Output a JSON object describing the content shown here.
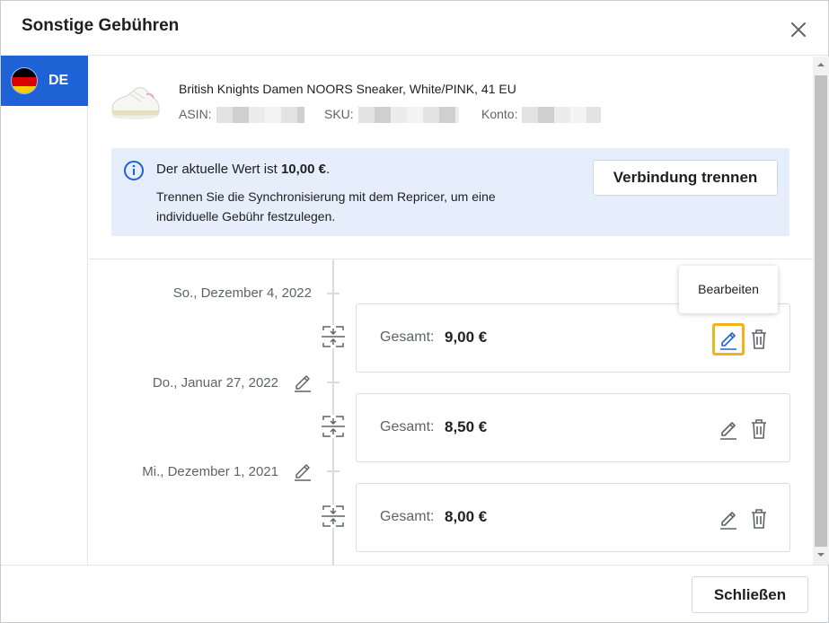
{
  "dialog": {
    "title": "Sonstige Gebühren"
  },
  "sidebar": {
    "marketplace_tab": {
      "label": "DE"
    }
  },
  "product": {
    "name": "British Knights Damen NOORS Sneaker, White/PINK, 41 EU",
    "asin_label": "ASIN:",
    "sku_label": "SKU:",
    "konto_label": "Konto:"
  },
  "info": {
    "text_prefix": "Der aktuelle Wert ist",
    "current_value": "10,00 €",
    "text_suffix": ".",
    "description": "Trennen Sie die Synchronisierung mit dem Repricer, um eine individuelle Gebühr festzulegen.",
    "disconnect_button": "Verbindung trennen"
  },
  "timeline": {
    "dates": [
      {
        "label": "So., Dezember 4, 2022",
        "editable": false
      },
      {
        "label": "Do., Januar 27, 2022",
        "editable": true
      },
      {
        "label": "Mi., Dezember 1, 2021",
        "editable": true
      }
    ],
    "entries": [
      {
        "label": "Gesamt:",
        "value": "9,00 €"
      },
      {
        "label": "Gesamt:",
        "value": "8,50 €"
      },
      {
        "label": "Gesamt:",
        "value": "8,00 €"
      }
    ]
  },
  "tooltip": {
    "text": "Bearbeiten"
  },
  "footer": {
    "close_button": "Schließen"
  },
  "colors": {
    "accent": "#1e62d6",
    "info_bg": "#e6eefb",
    "focus_ring": "#f3b21b"
  }
}
